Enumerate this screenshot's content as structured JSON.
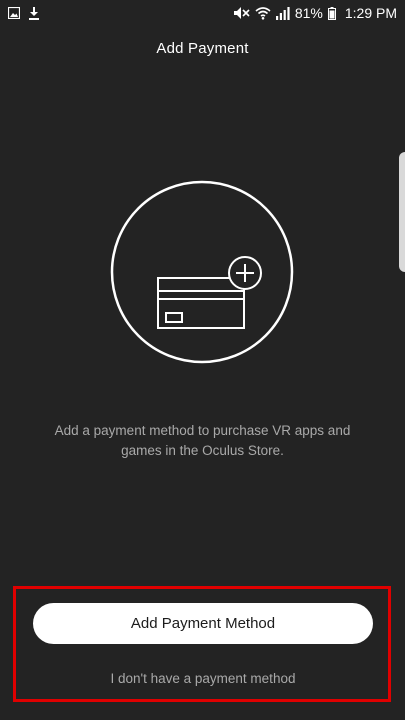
{
  "status_bar": {
    "left_icons": [
      "image-notification-icon",
      "download-icon"
    ],
    "right_icons": [
      "mute-icon",
      "wifi-icon",
      "signal-icon",
      "battery-icon"
    ],
    "battery": "81%",
    "time": "1:29 PM"
  },
  "header": {
    "title": "Add Payment"
  },
  "illustration": {
    "icon": "credit-card-add-icon"
  },
  "main": {
    "description": "Add a payment method to purchase VR apps and games in the Oculus Store."
  },
  "actions": {
    "primary_label": "Add Payment Method",
    "secondary_label": "I don't have a payment method"
  },
  "colors": {
    "background": "#232323",
    "highlight": "#e00000",
    "button": "#ffffff",
    "muted_text": "#a9a9a9"
  }
}
